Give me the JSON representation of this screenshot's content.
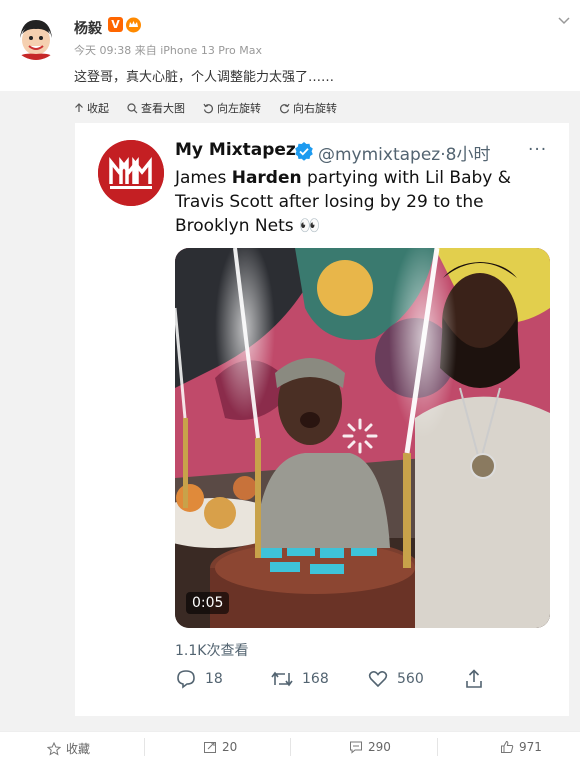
{
  "post": {
    "username": "杨毅",
    "v_badge": "V",
    "meta": "今天 09:38 来自 iPhone 13 Pro Max",
    "text": "这登哥，真大心脏，个人调整能力太强了……"
  },
  "toolbar": {
    "collect": "收起",
    "view_large": "查看大图",
    "rotate_left": "向左旋转",
    "rotate_right": "向右旋转"
  },
  "tweet": {
    "name": "My Mixtapez",
    "handle": "@mymixtapez·8小时",
    "more": "···",
    "body_pre": "James ",
    "body_bold": "Harden",
    "body_post": " partying with Lil Baby & Travis Scott after losing by 29 to the Brooklyn Nets 👀",
    "video_duration": "0:05",
    "views": "1.1K次查看",
    "replies": "18",
    "retweets": "168",
    "likes": "560"
  },
  "footer": {
    "favorite": "收藏",
    "share": "20",
    "comments": "290",
    "likes": "971"
  },
  "colors": {
    "accent_orange": "#ff6600",
    "verified_blue": "#1d9bf0",
    "logo_red": "#c41f23"
  }
}
